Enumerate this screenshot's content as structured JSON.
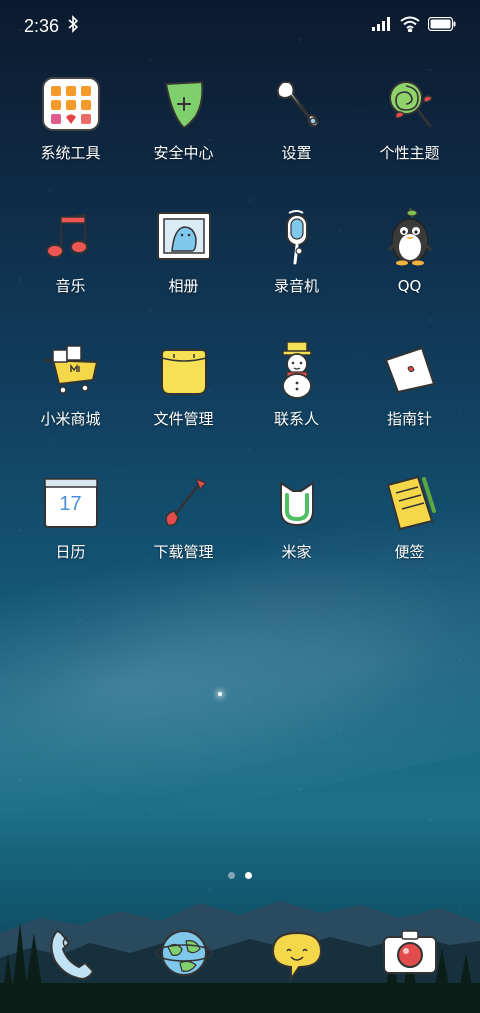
{
  "status_bar": {
    "time": "2:36",
    "bluetooth_icon": "bluetooth-icon",
    "signal_icon": "signal-icon",
    "wifi_icon": "wifi-icon",
    "battery_icon": "battery-icon"
  },
  "apps": [
    {
      "label": "系统工具",
      "icon": "system-tools-folder-icon"
    },
    {
      "label": "安全中心",
      "icon": "shield-icon"
    },
    {
      "label": "设置",
      "icon": "wrench-icon"
    },
    {
      "label": "个性主题",
      "icon": "lollipop-icon"
    },
    {
      "label": "音乐",
      "icon": "music-note-icon"
    },
    {
      "label": "相册",
      "icon": "picture-frame-icon"
    },
    {
      "label": "录音机",
      "icon": "microphone-icon"
    },
    {
      "label": "QQ",
      "icon": "penguin-icon"
    },
    {
      "label": "小米商城",
      "icon": "shopping-cart-icon"
    },
    {
      "label": "文件管理",
      "icon": "folder-icon"
    },
    {
      "label": "联系人",
      "icon": "snowman-icon"
    },
    {
      "label": "指南针",
      "icon": "compass-icon"
    },
    {
      "label": "日历",
      "icon": "calendar-icon",
      "badge": "17"
    },
    {
      "label": "下载管理",
      "icon": "arrow-download-icon"
    },
    {
      "label": "米家",
      "icon": "mijia-icon"
    },
    {
      "label": "便签",
      "icon": "notepad-icon"
    }
  ],
  "page_indicator": {
    "count": 2,
    "active": 2
  },
  "dock": [
    {
      "icon": "phone-icon"
    },
    {
      "icon": "browser-globe-icon"
    },
    {
      "icon": "messages-bubble-icon"
    },
    {
      "icon": "camera-icon"
    }
  ]
}
